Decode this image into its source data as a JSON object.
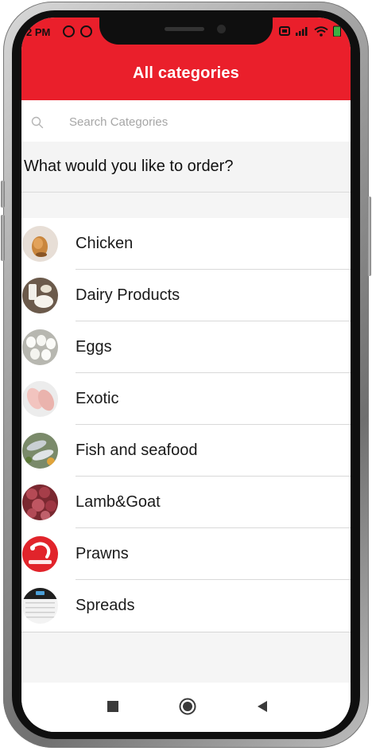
{
  "status_bar": {
    "time": "2 PM"
  },
  "header": {
    "title": "All categories"
  },
  "search": {
    "placeholder": "Search Categories",
    "value": ""
  },
  "prompt": {
    "heading": "What would you like to order?"
  },
  "categories": [
    {
      "label": "Chicken",
      "icon": "chicken-thumbnail"
    },
    {
      "label": "Dairy Products",
      "icon": "dairy-thumbnail"
    },
    {
      "label": "Eggs",
      "icon": "eggs-thumbnail"
    },
    {
      "label": "Exotic",
      "icon": "exotic-thumbnail"
    },
    {
      "label": "Fish and seafood",
      "icon": "fish-thumbnail"
    },
    {
      "label": "Lamb&Goat",
      "icon": "lamb-thumbnail"
    },
    {
      "label": "Prawns",
      "icon": "prawns-thumbnail"
    },
    {
      "label": "Spreads",
      "icon": "spreads-thumbnail"
    }
  ],
  "colors": {
    "brand_red": "#ea1f2b",
    "background": "#f4f4f4",
    "text": "#1a1a1a"
  },
  "nav": {
    "icons": [
      "recents-icon",
      "home-icon",
      "back-icon"
    ]
  }
}
